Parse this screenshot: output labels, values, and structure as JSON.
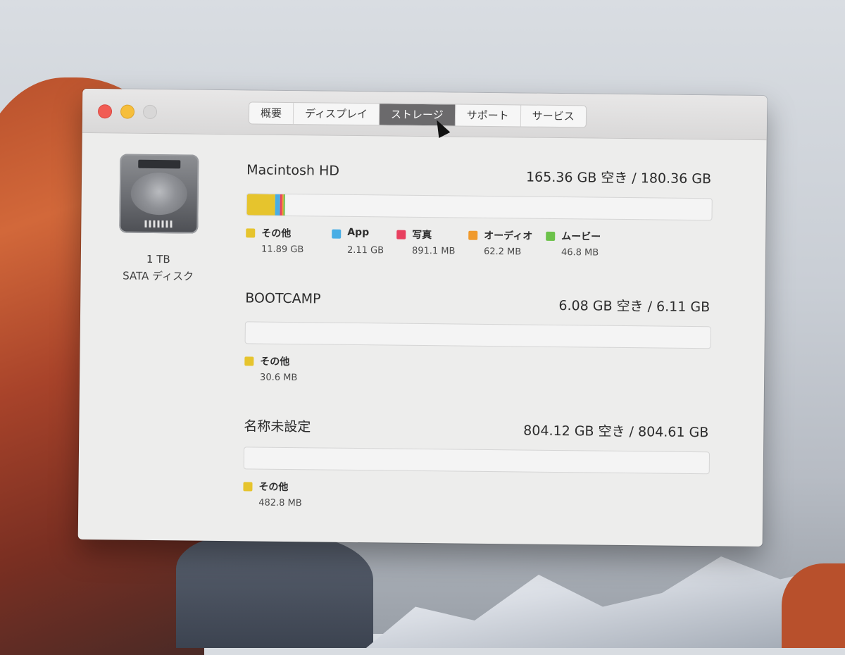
{
  "window": {
    "tabs": [
      {
        "label": "概要",
        "active": false
      },
      {
        "label": "ディスプレイ",
        "active": false
      },
      {
        "label": "ストレージ",
        "active": true
      },
      {
        "label": "サポート",
        "active": false
      },
      {
        "label": "サービス",
        "active": false
      }
    ]
  },
  "disk": {
    "capacity": "1 TB",
    "type": "SATA ディスク"
  },
  "volumes": [
    {
      "name": "Macintosh HD",
      "space": "165.36 GB 空き / 180.36 GB",
      "legend": [
        {
          "label": "その他",
          "value": "11.89 GB",
          "color": "#e6c42d"
        },
        {
          "label": "App",
          "value": "2.11 GB",
          "color": "#49aee5"
        },
        {
          "label": "写真",
          "value": "891.1 MB",
          "color": "#e8405f"
        },
        {
          "label": "オーディオ",
          "value": "62.2 MB",
          "color": "#f09a2d"
        },
        {
          "label": "ムービー",
          "value": "46.8 MB",
          "color": "#6cc24a"
        }
      ]
    },
    {
      "name": "BOOTCAMP",
      "space": "6.08 GB 空き / 6.11 GB",
      "legend": [
        {
          "label": "その他",
          "value": "30.6 MB",
          "color": "#e6c42d"
        }
      ]
    },
    {
      "name": "名称未設定",
      "space": "804.12 GB 空き / 804.61 GB",
      "legend": [
        {
          "label": "その他",
          "value": "482.8 MB",
          "color": "#e6c42d"
        }
      ]
    }
  ]
}
